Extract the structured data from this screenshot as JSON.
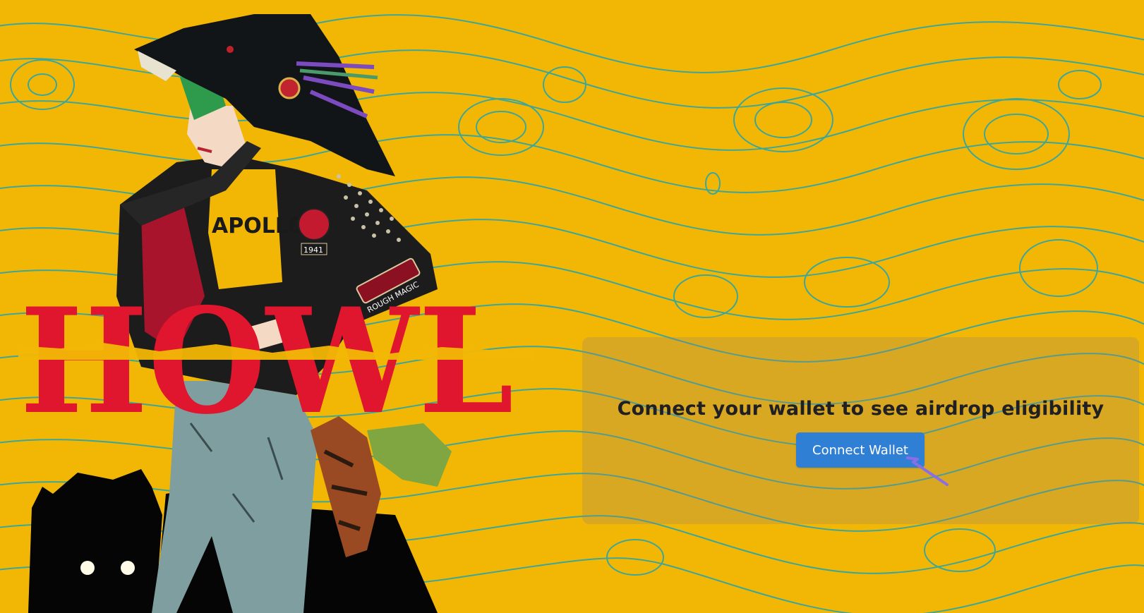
{
  "page": {
    "background_color": "#F2B705",
    "topo_line_color": "#2AA5A9"
  },
  "hero": {
    "logo_text": "HOWL",
    "logo_color": "#E0152E",
    "shirt_text": "APOLLO",
    "patch_text": "ROUGH MAGIC",
    "badge_text": "1941"
  },
  "airdrop": {
    "heading": "Connect your wallet to see airdrop eligibility",
    "connect_button_label": "Connect Wallet",
    "button_color": "#2F7FD4"
  },
  "icons": {
    "cursor": "cursor-arrow-icon"
  }
}
